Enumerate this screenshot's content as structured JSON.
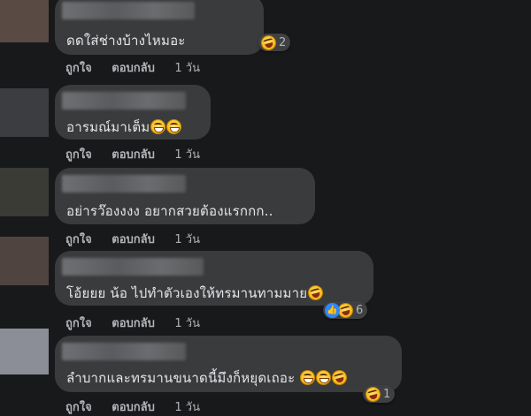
{
  "comments": [
    {
      "text": "ดดใส่ช่างบ้างไหมอะ",
      "reaction_count": "2",
      "reaction_icons": [
        "laugh-wow-icon"
      ],
      "like_label": "ถูกใจ",
      "reply_label": "ตอบกลับ",
      "time": "1 วัน",
      "avatar_color": "#5a4a44"
    },
    {
      "text": "อารมณ์มาเต็ม",
      "emojis": [
        "grin-icon",
        "grin-icon"
      ],
      "like_label": "ถูกใจ",
      "reply_label": "ตอบกลับ",
      "time": "1 วัน",
      "avatar_color": "#3b3d40"
    },
    {
      "text": "อย่ารว๊องงงง อยากสวยต้องแรกกก..",
      "like_label": "ถูกใจ",
      "reply_label": "ตอบกลับ",
      "time": "1 วัน",
      "avatar_color": "#3a3b35"
    },
    {
      "text": "โอ้ยยย น้อ ไปทำตัวเองให้ทรมานทามมาย",
      "emojis": [
        "laughing-tears-icon"
      ],
      "reaction_count": "6",
      "reaction_icons": [
        "like-icon",
        "laugh-icon"
      ],
      "like_label": "ถูกใจ",
      "reply_label": "ตอบกลับ",
      "time": "1 วัน",
      "avatar_color": "#4f4440"
    },
    {
      "text": "ลำบากและทรมานขนาดนี้มึงก็หยุดเถอะ",
      "emojis": [
        "grin-icon",
        "grin-icon",
        "laughing-tears-icon"
      ],
      "reaction_count": "1",
      "reaction_icons": [
        "laugh-icon"
      ],
      "like_label": "ถูกใจ",
      "reply_label": "ตอบกลับ",
      "time": "1 วัน",
      "avatar_color": "#8b8e96"
    }
  ],
  "colors": {
    "background": "#18191a",
    "bubble": "#3a3b3c",
    "text": "#e4e6eb",
    "meta": "#b0b3b8",
    "like_blue": "#2d88ff"
  }
}
